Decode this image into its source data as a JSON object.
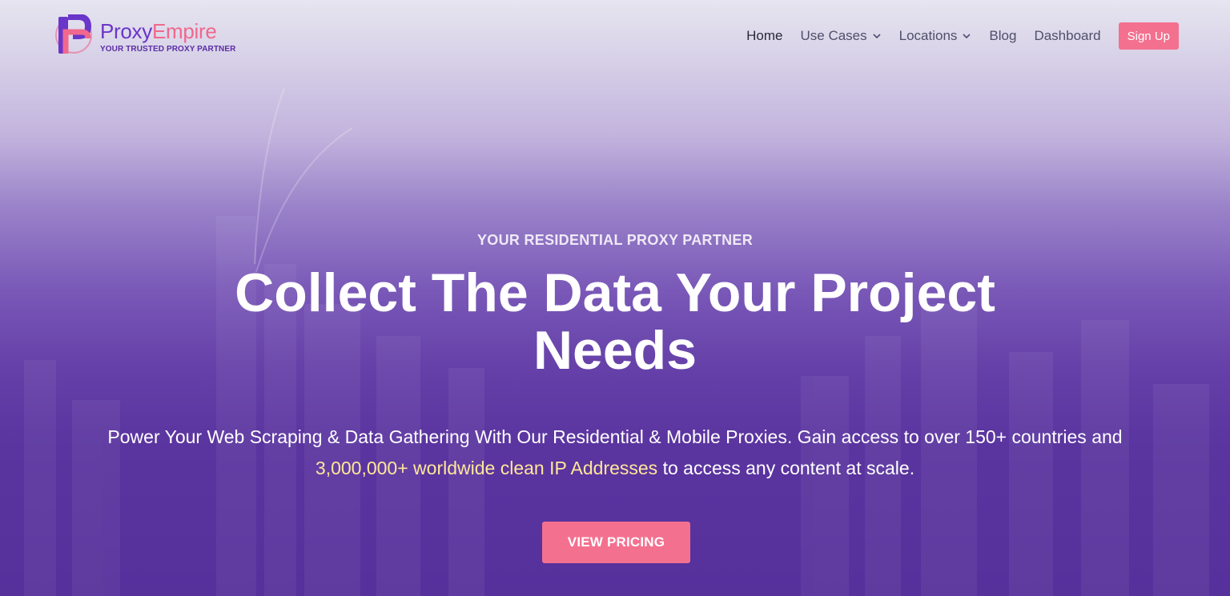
{
  "brand": {
    "name_part1": "Proxy",
    "name_part2": "Empire",
    "tagline": "YOUR TRUSTED PROXY PARTNER",
    "primary_color": "#6a35c9",
    "accent_color": "#f0688c"
  },
  "nav": {
    "items": [
      {
        "label": "Home",
        "active": true
      },
      {
        "label": "Use Cases",
        "has_dropdown": true
      },
      {
        "label": "Locations",
        "has_dropdown": true
      },
      {
        "label": "Blog"
      },
      {
        "label": "Dashboard"
      }
    ],
    "signup_label": "Sign Up"
  },
  "hero": {
    "eyebrow": "YOUR RESIDENTIAL PROXY PARTNER",
    "headline": "Collect The Data Your Project Needs",
    "subtext_before": "Power Your Web Scraping & Data Gathering  With Our Residential & Mobile Proxies. Gain access to over 150+ countries and ",
    "subtext_highlight": "3,000,000+ worldwide clean IP Addresses",
    "subtext_after": " to access any content at scale.",
    "cta_label": "VIEW PRICING",
    "cta_color": "#f4708f",
    "highlight_color": "#ffe79a"
  }
}
